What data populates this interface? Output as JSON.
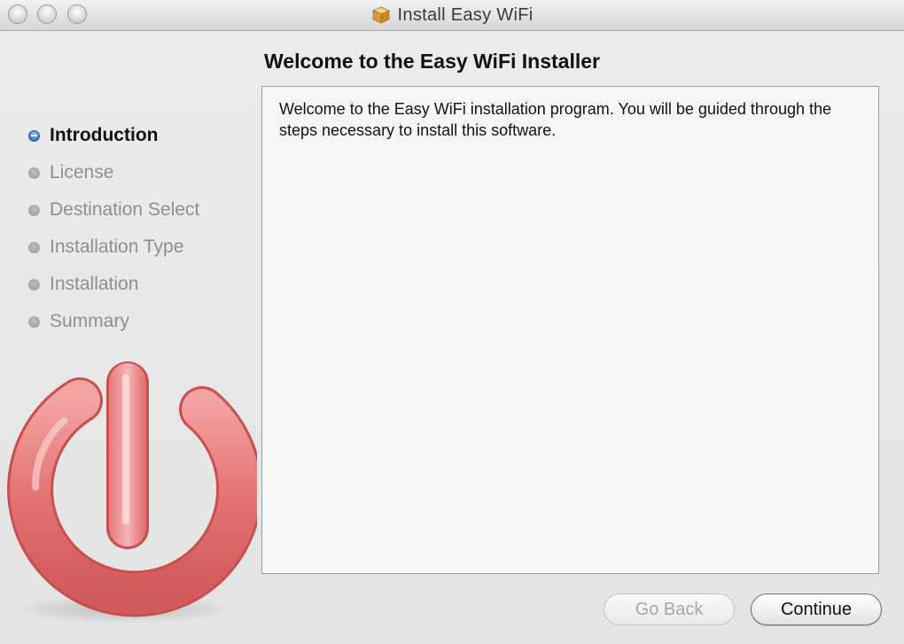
{
  "window": {
    "title": "Install Easy WiFi"
  },
  "page": {
    "heading": "Welcome to the Easy WiFi Installer",
    "body": "Welcome to the Easy WiFi installation program. You will be guided through the steps necessary to install this software."
  },
  "steps": [
    {
      "label": "Introduction",
      "active": true
    },
    {
      "label": "License",
      "active": false
    },
    {
      "label": "Destination Select",
      "active": false
    },
    {
      "label": "Installation Type",
      "active": false
    },
    {
      "label": "Installation",
      "active": false
    },
    {
      "label": "Summary",
      "active": false
    }
  ],
  "buttons": {
    "back_label": "Go Back",
    "continue_label": "Continue"
  },
  "icons": {
    "title_icon": "package-icon",
    "logo": "power-logo"
  },
  "colors": {
    "active_step_dot": "#3a76c9",
    "logo_red": "#e06b6b"
  }
}
